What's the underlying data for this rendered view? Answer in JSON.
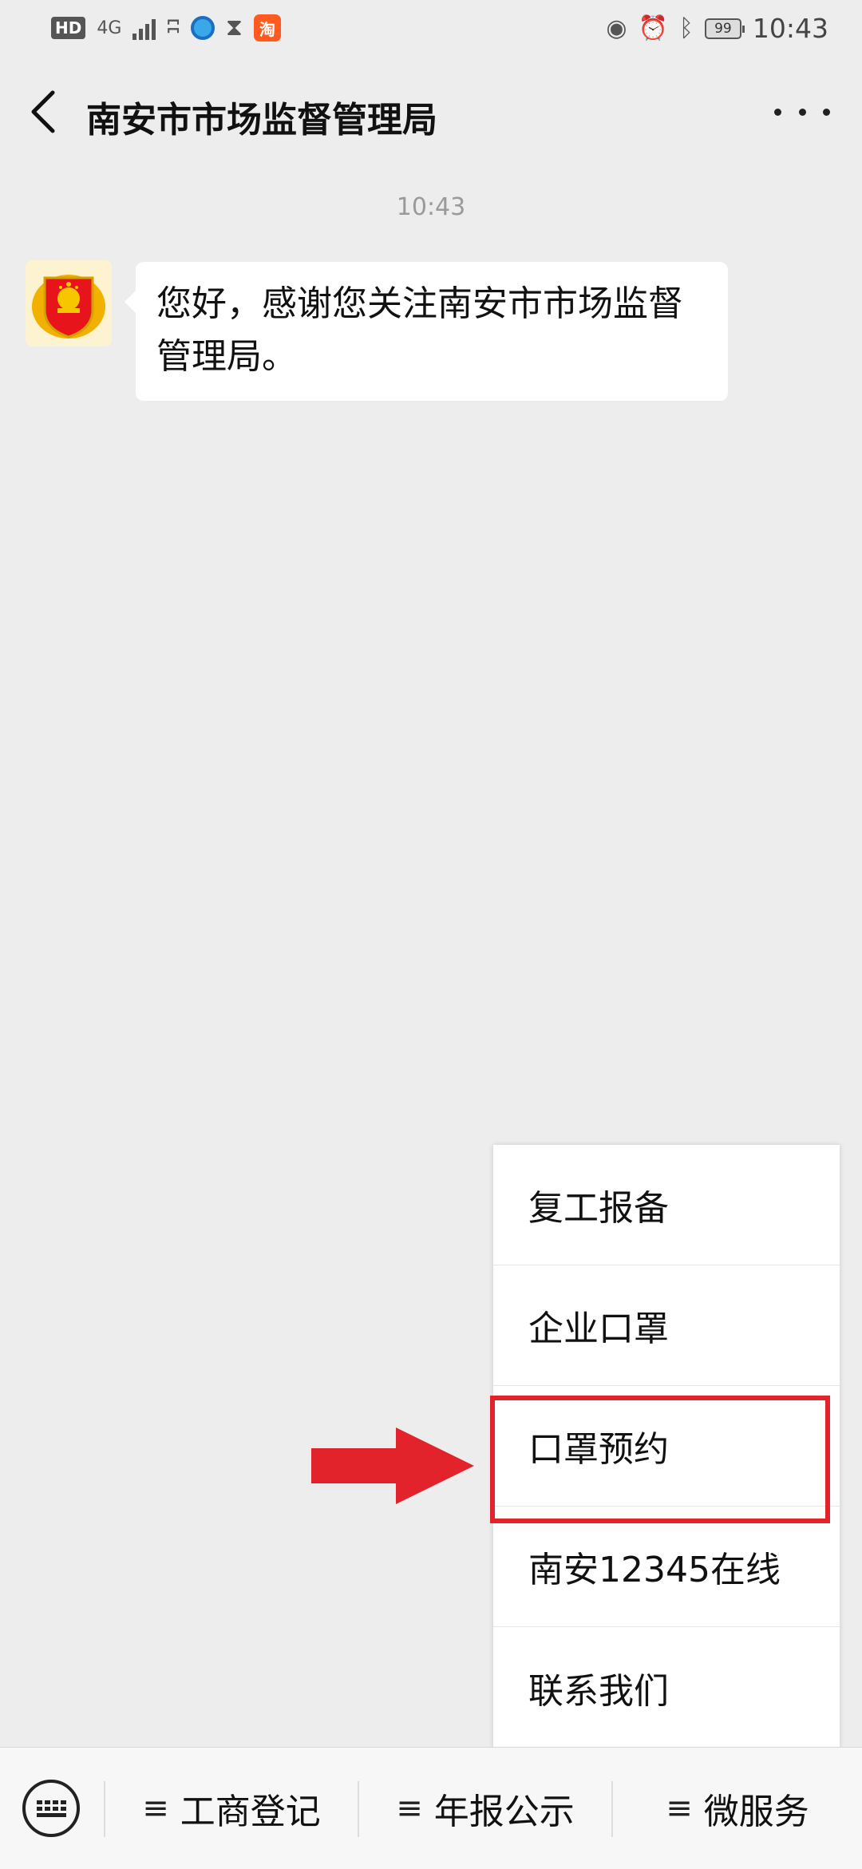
{
  "status_bar": {
    "hd": "HD",
    "network": "4G",
    "battery": "99",
    "time": "10:43"
  },
  "nav": {
    "title": "南安市市场监督管理局"
  },
  "chat": {
    "time": "10:43",
    "message": "您好，感谢您关注南安市市场监督管理局。"
  },
  "popup_menu": {
    "items": [
      "复工报备",
      "企业口罩",
      "口罩预约",
      "南安12345在线",
      "联系我们"
    ],
    "highlighted_item": "口罩预约",
    "highlight_color": "#e2232b"
  },
  "bottom_menu": {
    "buttons": [
      "工商登记",
      "年报公示",
      "微服务"
    ],
    "prefix_glyph": "≡"
  }
}
